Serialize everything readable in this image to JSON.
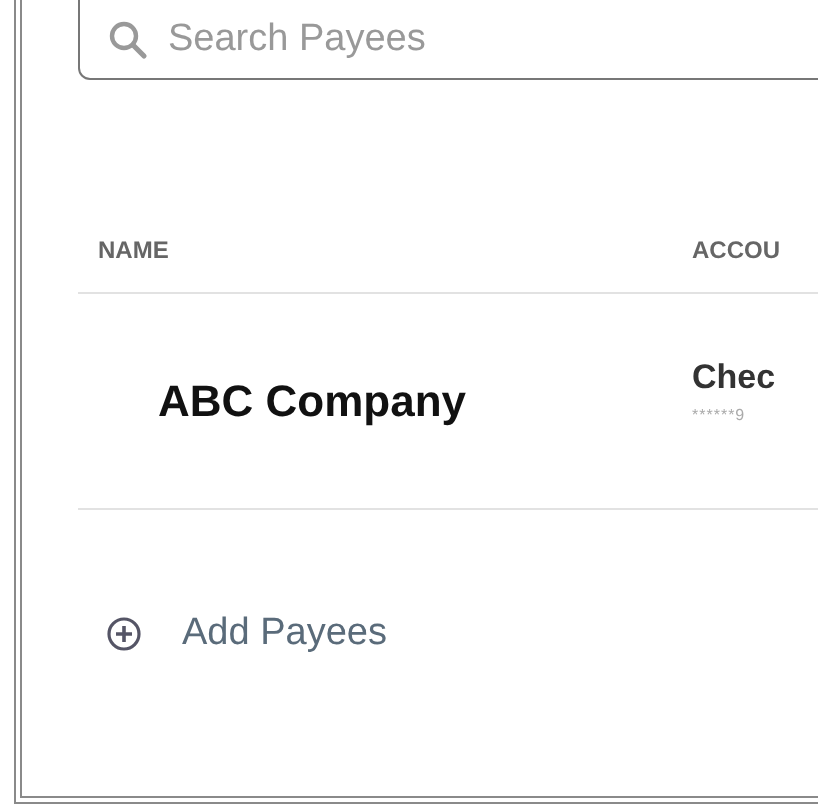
{
  "search": {
    "placeholder": "Search Payees"
  },
  "table": {
    "columns": [
      "NAME",
      "ACCOU"
    ],
    "rows": [
      {
        "name": "ABC Company",
        "account": "Chec",
        "account_number": "******9"
      }
    ]
  },
  "add_button": {
    "label": "Add Payees"
  }
}
